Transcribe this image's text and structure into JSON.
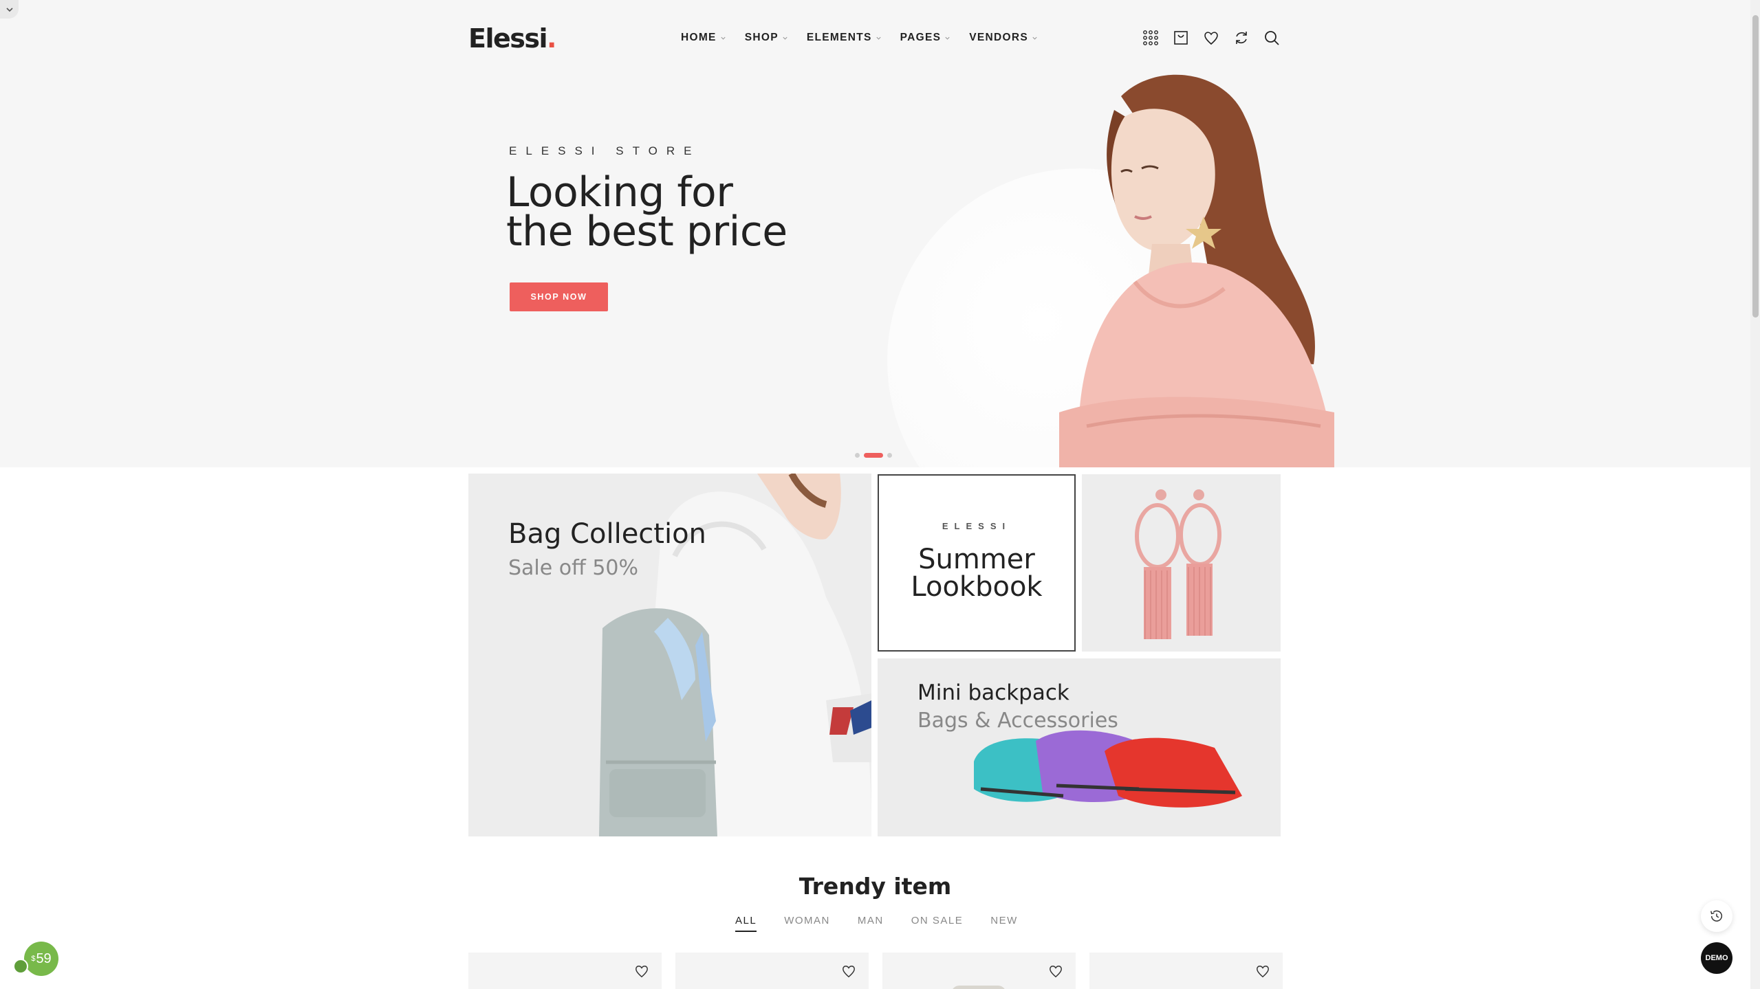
{
  "header": {
    "logo": "Elessi",
    "logo_dot": ".",
    "nav": [
      {
        "label": "HOME"
      },
      {
        "label": "SHOP"
      },
      {
        "label": "ELEMENTS"
      },
      {
        "label": "PAGES"
      },
      {
        "label": "VENDORS"
      }
    ],
    "icons": [
      "grid-icon",
      "cart-icon",
      "heart-icon",
      "compare-icon",
      "search-icon"
    ]
  },
  "hero": {
    "subtitle": "ELESSI STORE",
    "title_line1": "Looking for",
    "title_line2": "the best price",
    "button": "SHOP NOW",
    "slides_total": 3,
    "slide_active": 2
  },
  "banners": {
    "bag": {
      "title": "Bag Collection",
      "subtitle": "Sale off 50%"
    },
    "summer": {
      "brand": "ELESSI",
      "title_line1": "Summer",
      "title_line2": "Lookbook"
    },
    "mini": {
      "title": "Mini backpack",
      "subtitle": "Bags & Accessories"
    }
  },
  "trendy": {
    "title": "Trendy item",
    "tabs": [
      {
        "label": "ALL",
        "active": true
      },
      {
        "label": "WOMAN",
        "active": false
      },
      {
        "label": "MAN",
        "active": false
      },
      {
        "label": "ON SALE",
        "active": false
      },
      {
        "label": "NEW",
        "active": false
      }
    ]
  },
  "floating": {
    "demo": "DEMO",
    "price_currency": "$",
    "price_value": "59"
  },
  "colors": {
    "accent": "#ee5f5d",
    "hero_bg": "#f6f6f6",
    "badge_green": "#78b94a"
  }
}
